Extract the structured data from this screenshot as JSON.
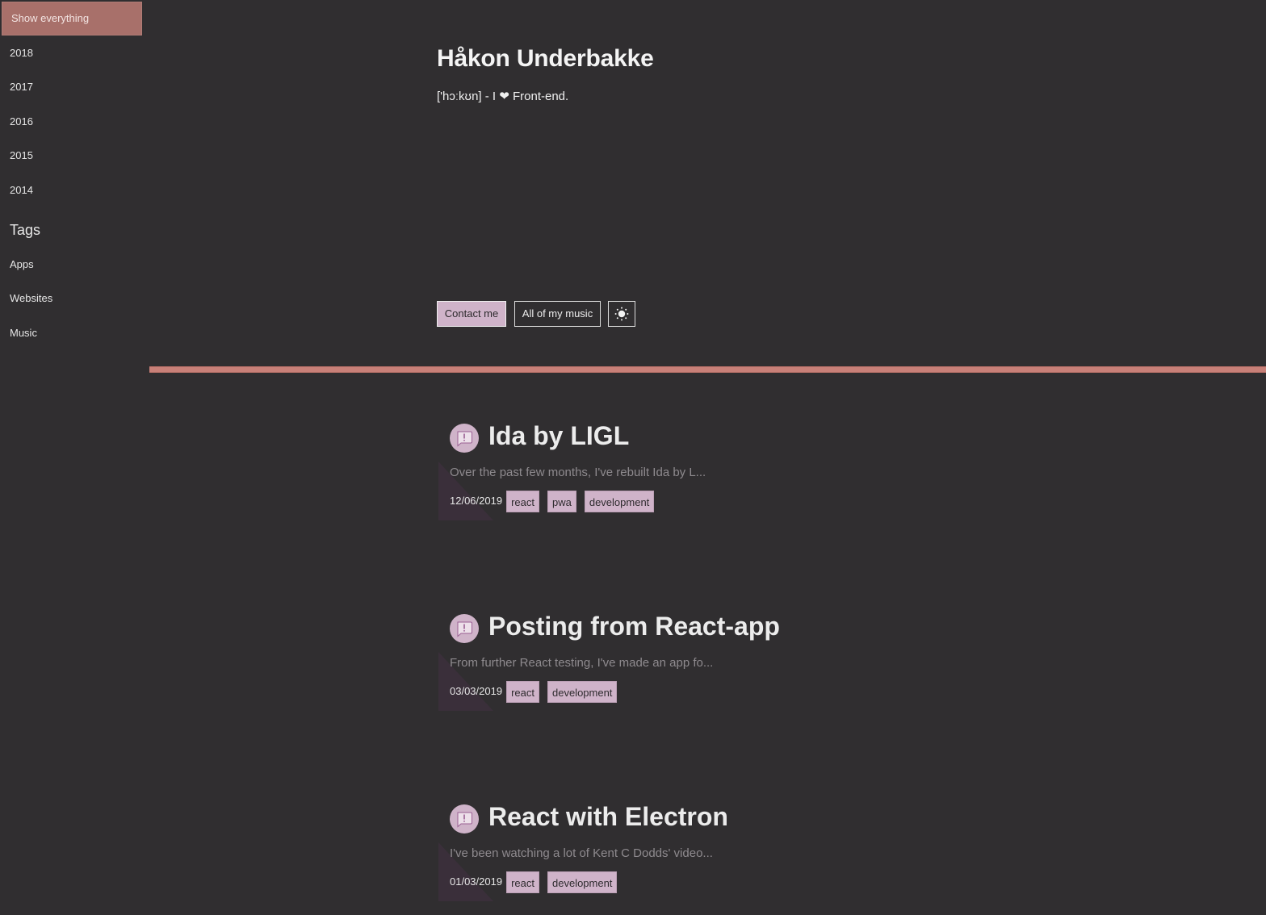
{
  "sidebar": {
    "filters": [
      {
        "label": "Show everything",
        "active": true
      },
      {
        "label": "2018"
      },
      {
        "label": "2017"
      },
      {
        "label": "2016"
      },
      {
        "label": "2015"
      },
      {
        "label": "2014"
      }
    ],
    "tags_heading": "Tags",
    "tags": [
      {
        "label": "Apps"
      },
      {
        "label": "Websites"
      },
      {
        "label": "Music"
      }
    ]
  },
  "header": {
    "title": "Håkon Underbakke",
    "tagline": "['hɔːkʊn] - I ❤ Front-end.",
    "buttons": {
      "contact": "Contact me",
      "music": "All of my music",
      "theme_icon": "sun-icon"
    }
  },
  "colors": {
    "background": "#302e30",
    "accent": "#a8706a",
    "divider": "#c88078",
    "tag": "#cfb3c9"
  },
  "posts": [
    {
      "icon": "announcement-icon",
      "title": "Ida by LIGL",
      "excerpt": "Over the past few months, I've rebuilt Ida by L...",
      "date": "12/06/2019",
      "tags": [
        "react",
        "pwa",
        "development"
      ]
    },
    {
      "icon": "announcement-icon",
      "title": "Posting from React-app",
      "excerpt": "From further React testing, I've made an app fo...",
      "date": "03/03/2019",
      "tags": [
        "react",
        "development"
      ]
    },
    {
      "icon": "announcement-icon",
      "title": "React with Electron",
      "excerpt": "I've been watching a lot of Kent C Dodds' video...",
      "date": "01/03/2019",
      "tags": [
        "react",
        "development"
      ]
    }
  ]
}
